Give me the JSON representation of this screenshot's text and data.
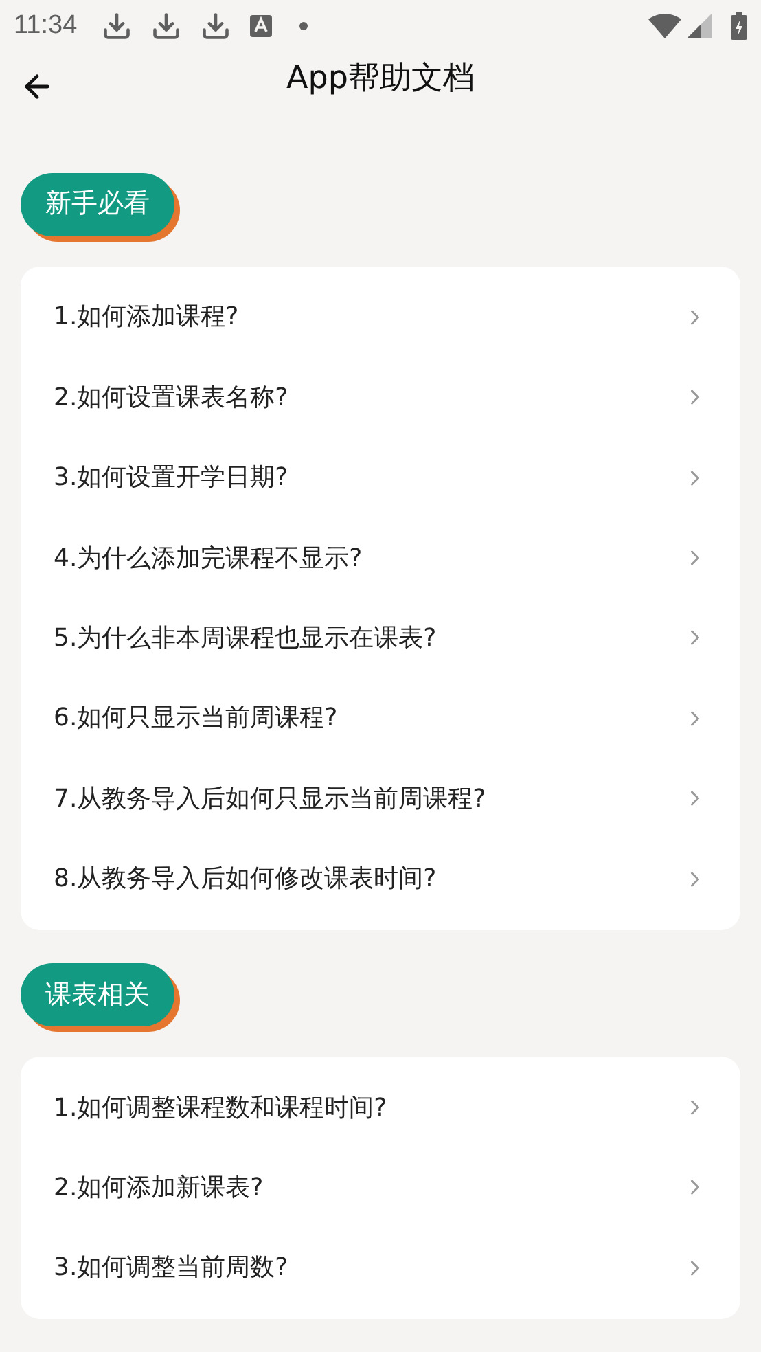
{
  "status_bar": {
    "time": "11:34"
  },
  "header": {
    "title": "App帮助文档"
  },
  "sections": [
    {
      "tag": "新手必看",
      "items": [
        "1.如何添加课程?",
        "2.如何设置课表名称?",
        "3.如何设置开学日期?",
        "4.为什么添加完课程不显示?",
        "5.为什么非本周课程也显示在课表?",
        "6.如何只显示当前周课程?",
        "7.从教务导入后如何只显示当前周课程?",
        "8.从教务导入后如何修改课表时间?"
      ]
    },
    {
      "tag": "课表相关",
      "items": [
        "1.如何调整课程数和课程时间?",
        "2.如何添加新课表?",
        "3.如何调整当前周数?"
      ]
    }
  ]
}
